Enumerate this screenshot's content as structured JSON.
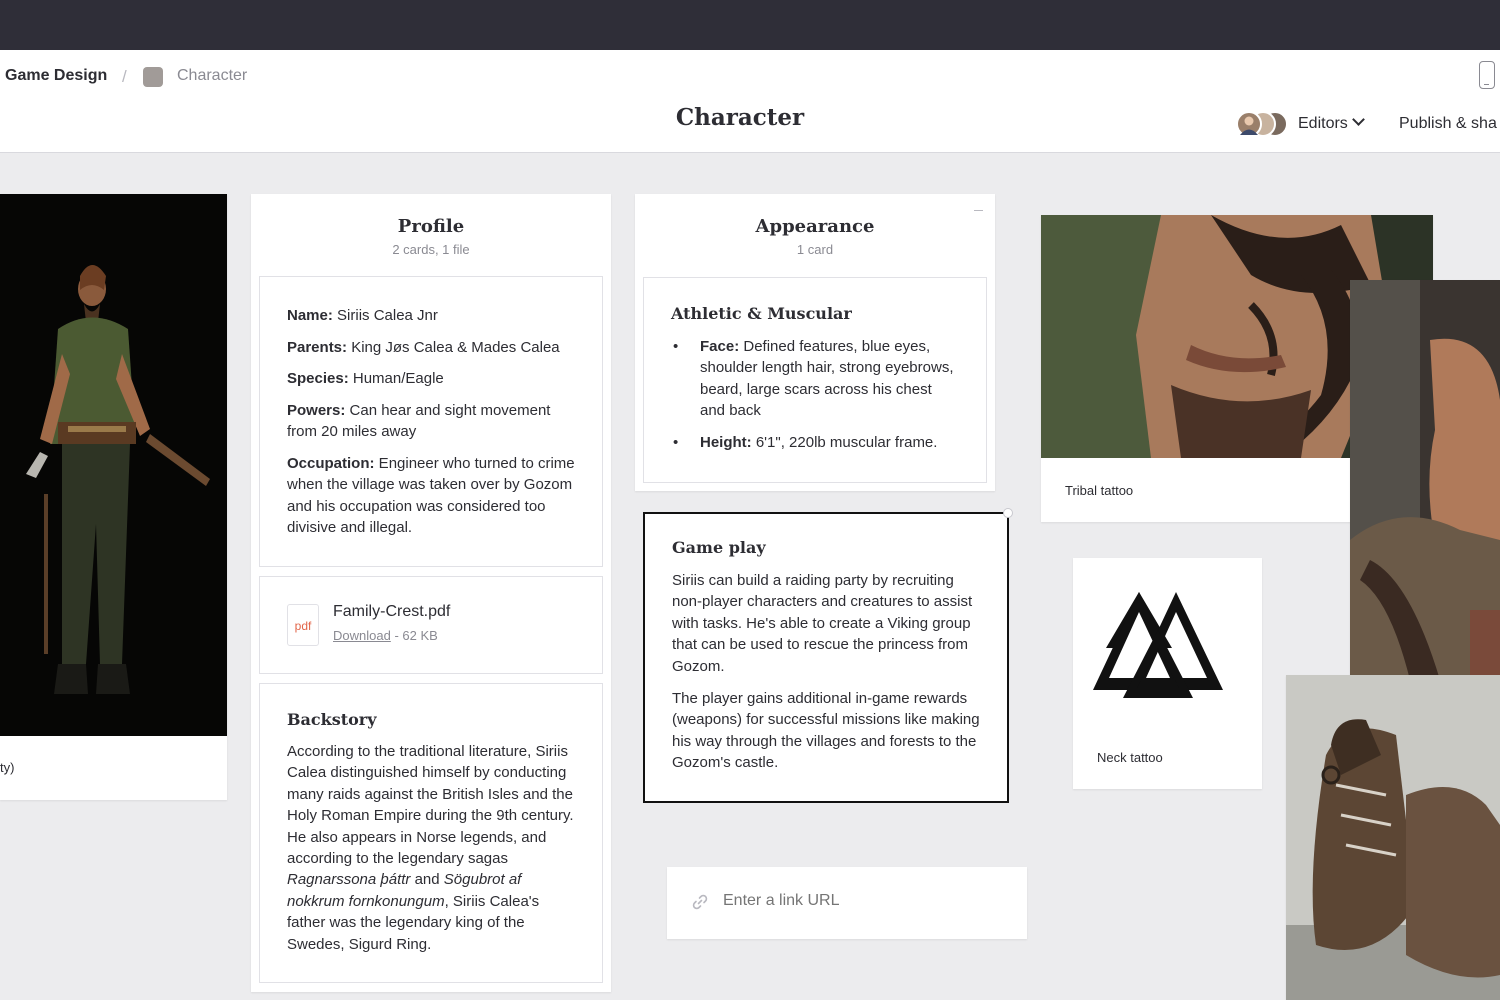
{
  "header": {
    "breadcrumb_root": "Game Design",
    "breadcrumb_separator": "/",
    "breadcrumb_current": "Character",
    "title": "Character",
    "editors_label": "Editors",
    "publish_label": "Publish & sha"
  },
  "images": {
    "left_caption": "ty)",
    "tribal_caption": "Tribal tattoo",
    "neck_caption": "Neck tattoo"
  },
  "profile": {
    "title": "Profile",
    "subtitle": "2 cards, 1 file",
    "fields": [
      {
        "label": "Name:",
        "value": " Siriis Calea Jnr"
      },
      {
        "label": "Parents:",
        "value": " King Jøs Calea & Mades Calea"
      },
      {
        "label": "Species:",
        "value": " Human/Eagle"
      },
      {
        "label": "Powers:",
        "value": " Can hear and sight movement from 20 miles away"
      },
      {
        "label": "Occupation:",
        "value": " Engineer who turned to crime when the village was taken over by Gozom and his occupation was considered too divisive and illegal."
      }
    ],
    "file": {
      "icon_text": "pdf",
      "name": "Family-Crest.pdf",
      "download_label": "Download",
      "size": " - 62 KB"
    },
    "backstory": {
      "title": "Backstory",
      "text_1": "According to the traditional literature, Siriis Calea distinguished himself by conducting many raids against the British Isles and the Holy Roman Empire during the 9th century. He also appears in Norse legends, and according to the legendary sagas ",
      "italic_1": "Ragnarssona þáttr",
      "text_2": " and ",
      "italic_2": "Sögubrot af nokkrum fornkonungum",
      "text_3": ", Siriis Calea's father was the legendary king of the Swedes, Sigurd Ring."
    }
  },
  "appearance": {
    "title": "Appearance",
    "subtitle": "1 card",
    "note_title": "Athletic & Muscular",
    "bullets": [
      {
        "label": "Face:",
        "value": " Defined features, blue eyes, shoulder length hair, strong eyebrows, beard, large scars across his chest and back"
      },
      {
        "label": "Height:",
        "value": " 6'1\", 220lb muscular frame."
      }
    ]
  },
  "gameplay": {
    "title": "Game play",
    "para_1": "Siriis can build a raiding party by recruiting non-player characters and creatures to assist with tasks. He's able to create a Viking group that can be used to rescue the princess from Gozom.",
    "para_2": "The player gains additional in-game rewards (weapons) for successful missions like making his way through the villages and forests to the Gozom's castle."
  },
  "link_input": {
    "placeholder": "Enter a link URL"
  },
  "icons": [
    "phone-preview-icon",
    "chevron-down-icon",
    "link-icon",
    "pdf-file-icon",
    "valknut-symbol"
  ],
  "colors": {
    "topbar": "#2f2e38",
    "canvas": "#ececee",
    "pdf_accent": "#e2664a",
    "selected_border": "#111111"
  }
}
